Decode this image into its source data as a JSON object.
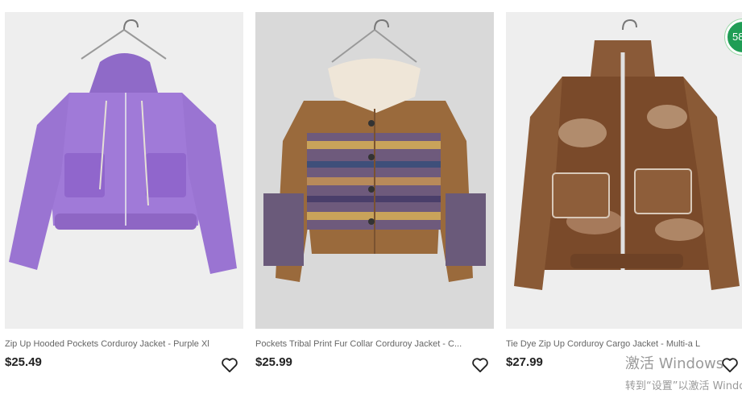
{
  "products": [
    {
      "title": "Zip Up Hooded Pockets Corduroy Jacket - Purple Xl",
      "price": "$25.49",
      "image_icon": "purple-corduroy-hooded-jacket"
    },
    {
      "title": "Pockets Tribal Print Fur Collar Corduroy Jacket - C...",
      "price": "$25.99",
      "image_icon": "tribal-print-corduroy-jacket"
    },
    {
      "title": "Tie Dye Zip Up Corduroy Cargo Jacket - Multi-a L",
      "price": "$27.99",
      "image_icon": "tie-dye-cargo-jacket"
    }
  ],
  "badge": {
    "text": "58"
  },
  "watermark": {
    "line1": "激活 Windows",
    "line2": "转到“设置”以激活 Windows。"
  },
  "colors": {
    "purple": "#a07ad8",
    "brown": "#9a6a3c",
    "tiedye": "#7a4a2a",
    "badge_green": "#1f9d55"
  }
}
